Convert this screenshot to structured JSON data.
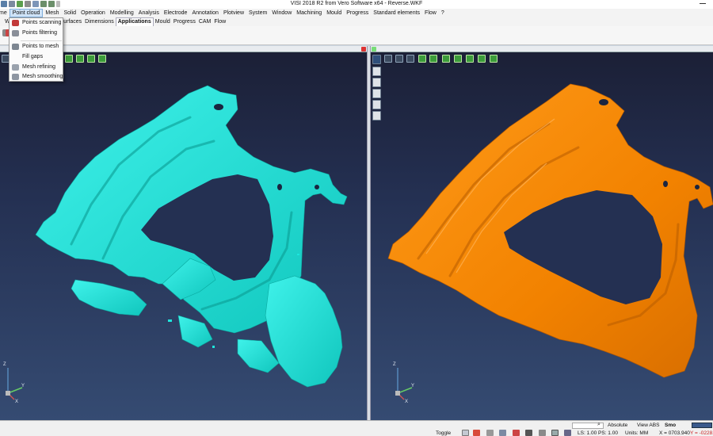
{
  "window": {
    "title": "VISI 2018 R2 from Vero Software x64 - Reverse.WKF"
  },
  "menubar": {
    "items": [
      {
        "label": "me"
      },
      {
        "label": "Point cloud",
        "active": true
      },
      {
        "label": "Mesh"
      },
      {
        "label": "Solid"
      },
      {
        "label": "Operation"
      },
      {
        "label": "Modelling"
      },
      {
        "label": "Analysis"
      },
      {
        "label": "Electrode"
      },
      {
        "label": "Annotation"
      },
      {
        "label": "Plotview"
      },
      {
        "label": "System"
      },
      {
        "label": "Window"
      },
      {
        "label": "Machining"
      },
      {
        "label": "Mould"
      },
      {
        "label": "Progress"
      },
      {
        "label": "Standard elements"
      },
      {
        "label": "Flow"
      },
      {
        "label": "?"
      }
    ]
  },
  "ribbon_tabs": {
    "items": [
      {
        "label": "Wi"
      },
      {
        "label": "urfaces"
      },
      {
        "label": "Dimensions"
      },
      {
        "label": "Applications",
        "selected": true
      },
      {
        "label": "Mould"
      },
      {
        "label": "Progress"
      },
      {
        "label": "CAM"
      },
      {
        "label": "Flow"
      }
    ]
  },
  "dropdown": {
    "items": [
      {
        "label": "Points scanning",
        "icon": "points-scanning-icon"
      },
      {
        "label": "Points filtering",
        "icon": "points-filtering-icon"
      },
      {
        "label": "Points to mesh",
        "icon": "points-to-mesh-icon"
      },
      {
        "label": "Fill gaps",
        "icon": "fill-gaps-icon"
      },
      {
        "label": "Mesh refining",
        "icon": "mesh-refining-icon"
      },
      {
        "label": "Mesh smoothing",
        "icon": "mesh-smoothing-icon"
      }
    ]
  },
  "viewports": {
    "left": {
      "model_color": "#1ee6dc",
      "axis_labels": [
        "Z",
        "Y",
        "X"
      ]
    },
    "right": {
      "model_color": "#ff8a00",
      "axis_labels": [
        "Z",
        "Y",
        "X"
      ]
    }
  },
  "statusbar": {
    "toggle_label": "Toggle",
    "absolute_label": "Absolute",
    "view_label": "View ABS",
    "smooth_label": "Smo",
    "scale_label": "LS: 1.00 PS: 1.00",
    "units_label": "Units: MM",
    "x_coord": "X = 0703.940",
    "y_coord": "Y = -0228."
  },
  "colors": {
    "accent": "#cfe3f7",
    "viewport_top": "#1b1f35",
    "viewport_bottom": "#354b72",
    "cyan_model": "#1ee6dc",
    "orange_model": "#ff8a00"
  }
}
